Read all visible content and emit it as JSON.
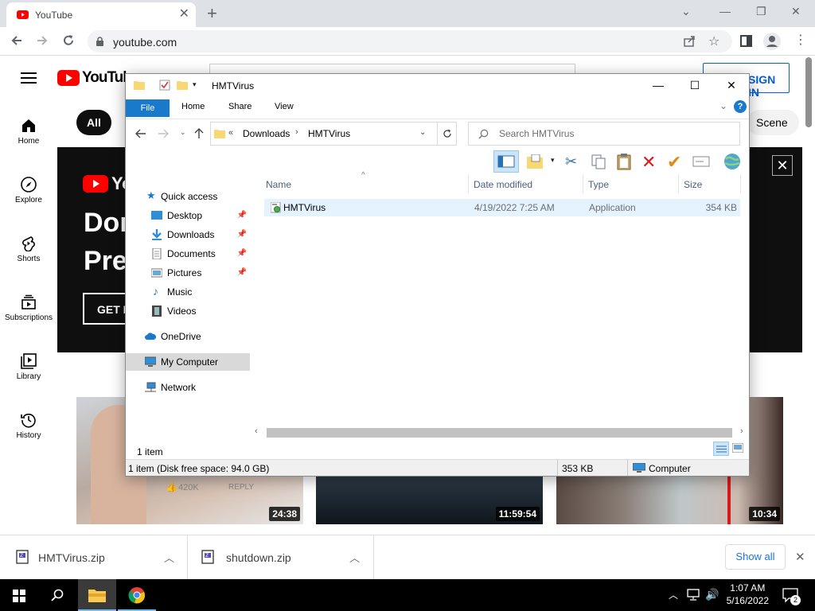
{
  "browser": {
    "tab_title": "YouTube",
    "url": "youtube.com"
  },
  "youtube": {
    "logo_text": "YouTube",
    "sign_in": "SIGN IN",
    "chip_all": "All",
    "chip_scene": "Scene",
    "sidebar": [
      {
        "label": "Home"
      },
      {
        "label": "Explore"
      },
      {
        "label": "Shorts"
      },
      {
        "label": "Subscriptions"
      },
      {
        "label": "Library"
      },
      {
        "label": "History"
      }
    ],
    "banner": {
      "line1": "Dor",
      "line2": "Pre",
      "button": "GET I"
    },
    "videos": [
      {
        "duration": "24:38",
        "likes": "420K",
        "reply": "REPLY"
      },
      {
        "duration": "11:59:54"
      },
      {
        "duration": "10:34"
      }
    ]
  },
  "explorer": {
    "title": "HMTVirus",
    "ribbon_tabs": [
      "File",
      "Home",
      "Share",
      "View"
    ],
    "breadcrumb": {
      "prefix": "«",
      "items": [
        "Downloads",
        "HMTVirus"
      ]
    },
    "search_placeholder": "Search HMTVirus",
    "nav": {
      "quick_access": "Quick access",
      "items": [
        {
          "label": "Desktop",
          "pinned": true
        },
        {
          "label": "Downloads",
          "pinned": true
        },
        {
          "label": "Documents",
          "pinned": true
        },
        {
          "label": "Pictures",
          "pinned": true
        },
        {
          "label": "Music",
          "pinned": false
        },
        {
          "label": "Videos",
          "pinned": false
        }
      ],
      "onedrive": "OneDrive",
      "my_computer": "My Computer",
      "network": "Network"
    },
    "columns": {
      "name": "Name",
      "date": "Date modified",
      "type": "Type",
      "size": "Size"
    },
    "files": [
      {
        "name": "HMTVirus",
        "date": "4/19/2022 7:25 AM",
        "type": "Application",
        "size": "354 KB"
      }
    ],
    "item_count": "1 item",
    "status": {
      "left": "1 item (Disk free space: 94.0 GB)",
      "size": "353 KB",
      "location": "Computer"
    }
  },
  "downloads": {
    "items": [
      {
        "name": "HMTVirus.zip"
      },
      {
        "name": "shutdown.zip"
      }
    ],
    "show_all": "Show all"
  },
  "taskbar": {
    "time": "1:07 AM",
    "date": "5/16/2022",
    "notifications": "2"
  }
}
